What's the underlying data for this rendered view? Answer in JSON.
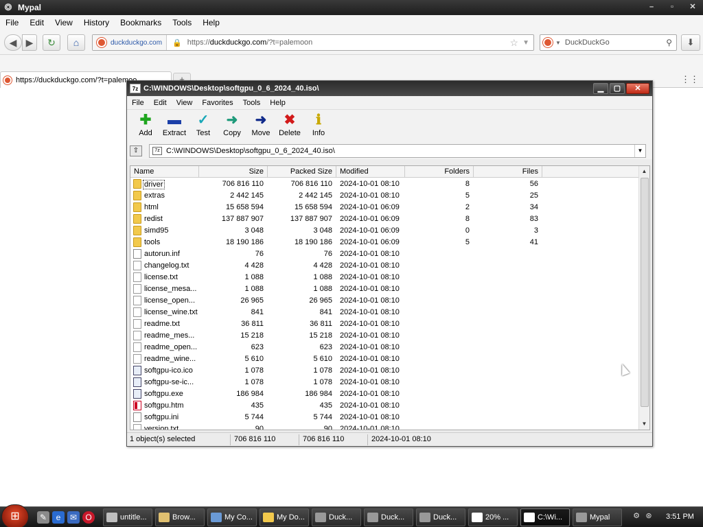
{
  "browser": {
    "title": "Mypal",
    "window_buttons": [
      "–",
      "▫",
      "✕"
    ],
    "menu": [
      "File",
      "Edit",
      "View",
      "History",
      "Bookmarks",
      "Tools",
      "Help"
    ],
    "identity": "duckduckgo.com",
    "url_prefix": "https://",
    "url_host": "duckduckgo.com",
    "url_path": "/?t=palemoon",
    "search_placeholder": "DuckDuckGo",
    "tab_title": "https://duckduckgo.com/?t=palemoo",
    "newtab_label": "+"
  },
  "zip": {
    "title": "C:\\WINDOWS\\Desktop\\softgpu_0_6_2024_40.iso\\",
    "icon_text": "7z",
    "menu": [
      "File",
      "Edit",
      "View",
      "Favorites",
      "Tools",
      "Help"
    ],
    "toolbar": {
      "add": "Add",
      "extract": "Extract",
      "test": "Test",
      "copy": "Copy",
      "move": "Move",
      "delete": "Delete",
      "info": "Info"
    },
    "path": "C:\\WINDOWS\\Desktop\\softgpu_0_6_2024_40.iso\\",
    "columns": {
      "name": "Name",
      "size": "Size",
      "packed": "Packed Size",
      "modified": "Modified",
      "folders": "Folders",
      "files": "Files"
    },
    "rows": [
      {
        "name": "driver",
        "type": "folder",
        "size": "706 816 110",
        "packed": "706 816 110",
        "modified": "2024-10-01 08:10",
        "folders": "8",
        "files": "56",
        "selected": true
      },
      {
        "name": "extras",
        "type": "folder",
        "size": "2 442 145",
        "packed": "2 442 145",
        "modified": "2024-10-01 08:10",
        "folders": "5",
        "files": "25"
      },
      {
        "name": "html",
        "type": "folder",
        "size": "15 658 594",
        "packed": "15 658 594",
        "modified": "2024-10-01 06:09",
        "folders": "2",
        "files": "34"
      },
      {
        "name": "redist",
        "type": "folder",
        "size": "137 887 907",
        "packed": "137 887 907",
        "modified": "2024-10-01 06:09",
        "folders": "8",
        "files": "83"
      },
      {
        "name": "simd95",
        "type": "folder",
        "size": "3 048",
        "packed": "3 048",
        "modified": "2024-10-01 06:09",
        "folders": "0",
        "files": "3"
      },
      {
        "name": "tools",
        "type": "folder",
        "size": "18 190 186",
        "packed": "18 190 186",
        "modified": "2024-10-01 06:09",
        "folders": "5",
        "files": "41"
      },
      {
        "name": "autorun.inf",
        "type": "gear",
        "size": "76",
        "packed": "76",
        "modified": "2024-10-01 08:10",
        "folders": "",
        "files": ""
      },
      {
        "name": "changelog.txt",
        "type": "file",
        "size": "4 428",
        "packed": "4 428",
        "modified": "2024-10-01 08:10",
        "folders": "",
        "files": ""
      },
      {
        "name": "license.txt",
        "type": "file",
        "size": "1 088",
        "packed": "1 088",
        "modified": "2024-10-01 08:10",
        "folders": "",
        "files": ""
      },
      {
        "name": "license_mesa...",
        "type": "file",
        "size": "1 088",
        "packed": "1 088",
        "modified": "2024-10-01 08:10",
        "folders": "",
        "files": ""
      },
      {
        "name": "license_open...",
        "type": "file",
        "size": "26 965",
        "packed": "26 965",
        "modified": "2024-10-01 08:10",
        "folders": "",
        "files": ""
      },
      {
        "name": "license_wine.txt",
        "type": "file",
        "size": "841",
        "packed": "841",
        "modified": "2024-10-01 08:10",
        "folders": "",
        "files": ""
      },
      {
        "name": "readme.txt",
        "type": "file",
        "size": "36 811",
        "packed": "36 811",
        "modified": "2024-10-01 08:10",
        "folders": "",
        "files": ""
      },
      {
        "name": "readme_mes...",
        "type": "file",
        "size": "15 218",
        "packed": "15 218",
        "modified": "2024-10-01 08:10",
        "folders": "",
        "files": ""
      },
      {
        "name": "readme_open...",
        "type": "file",
        "size": "623",
        "packed": "623",
        "modified": "2024-10-01 08:10",
        "folders": "",
        "files": ""
      },
      {
        "name": "readme_wine...",
        "type": "file",
        "size": "5 610",
        "packed": "5 610",
        "modified": "2024-10-01 08:10",
        "folders": "",
        "files": ""
      },
      {
        "name": "softgpu-ico.ico",
        "type": "exe",
        "size": "1 078",
        "packed": "1 078",
        "modified": "2024-10-01 08:10",
        "folders": "",
        "files": ""
      },
      {
        "name": "softgpu-se-ic...",
        "type": "exe",
        "size": "1 078",
        "packed": "1 078",
        "modified": "2024-10-01 08:10",
        "folders": "",
        "files": ""
      },
      {
        "name": "softgpu.exe",
        "type": "exe",
        "size": "186 984",
        "packed": "186 984",
        "modified": "2024-10-01 08:10",
        "folders": "",
        "files": ""
      },
      {
        "name": "softgpu.htm",
        "type": "htm",
        "size": "435",
        "packed": "435",
        "modified": "2024-10-01 08:10",
        "folders": "",
        "files": ""
      },
      {
        "name": "softgpu.ini",
        "type": "gear",
        "size": "5 744",
        "packed": "5 744",
        "modified": "2024-10-01 08:10",
        "folders": "",
        "files": ""
      },
      {
        "name": "version.txt",
        "type": "file",
        "size": "90",
        "packed": "90",
        "modified": "2024-10-01 08:10",
        "folders": "",
        "files": ""
      }
    ],
    "status": {
      "selected": "1 object(s) selected",
      "size": "706 816 110",
      "packed": "706 816 110",
      "modified": "2024-10-01 08:10"
    }
  },
  "taskbar": {
    "start_label": "⊞",
    "buttons": [
      {
        "label": "untitle...",
        "color": "#bfbfbf"
      },
      {
        "label": "Brow...",
        "color": "#e0c070"
      },
      {
        "label": "My Co...",
        "color": "#6a9ad6"
      },
      {
        "label": "My Do...",
        "color": "#f2c94c"
      },
      {
        "label": "Duck...",
        "color": "#999999"
      },
      {
        "label": "Duck...",
        "color": "#999999"
      },
      {
        "label": "Duck...",
        "color": "#999999"
      },
      {
        "label": "20% ...",
        "color": "#ffffff"
      },
      {
        "label": "C:\\Wi...",
        "color": "#ffffff",
        "active": true
      },
      {
        "label": "Mypal",
        "color": "#999999"
      }
    ],
    "clock": "3:51 PM"
  }
}
